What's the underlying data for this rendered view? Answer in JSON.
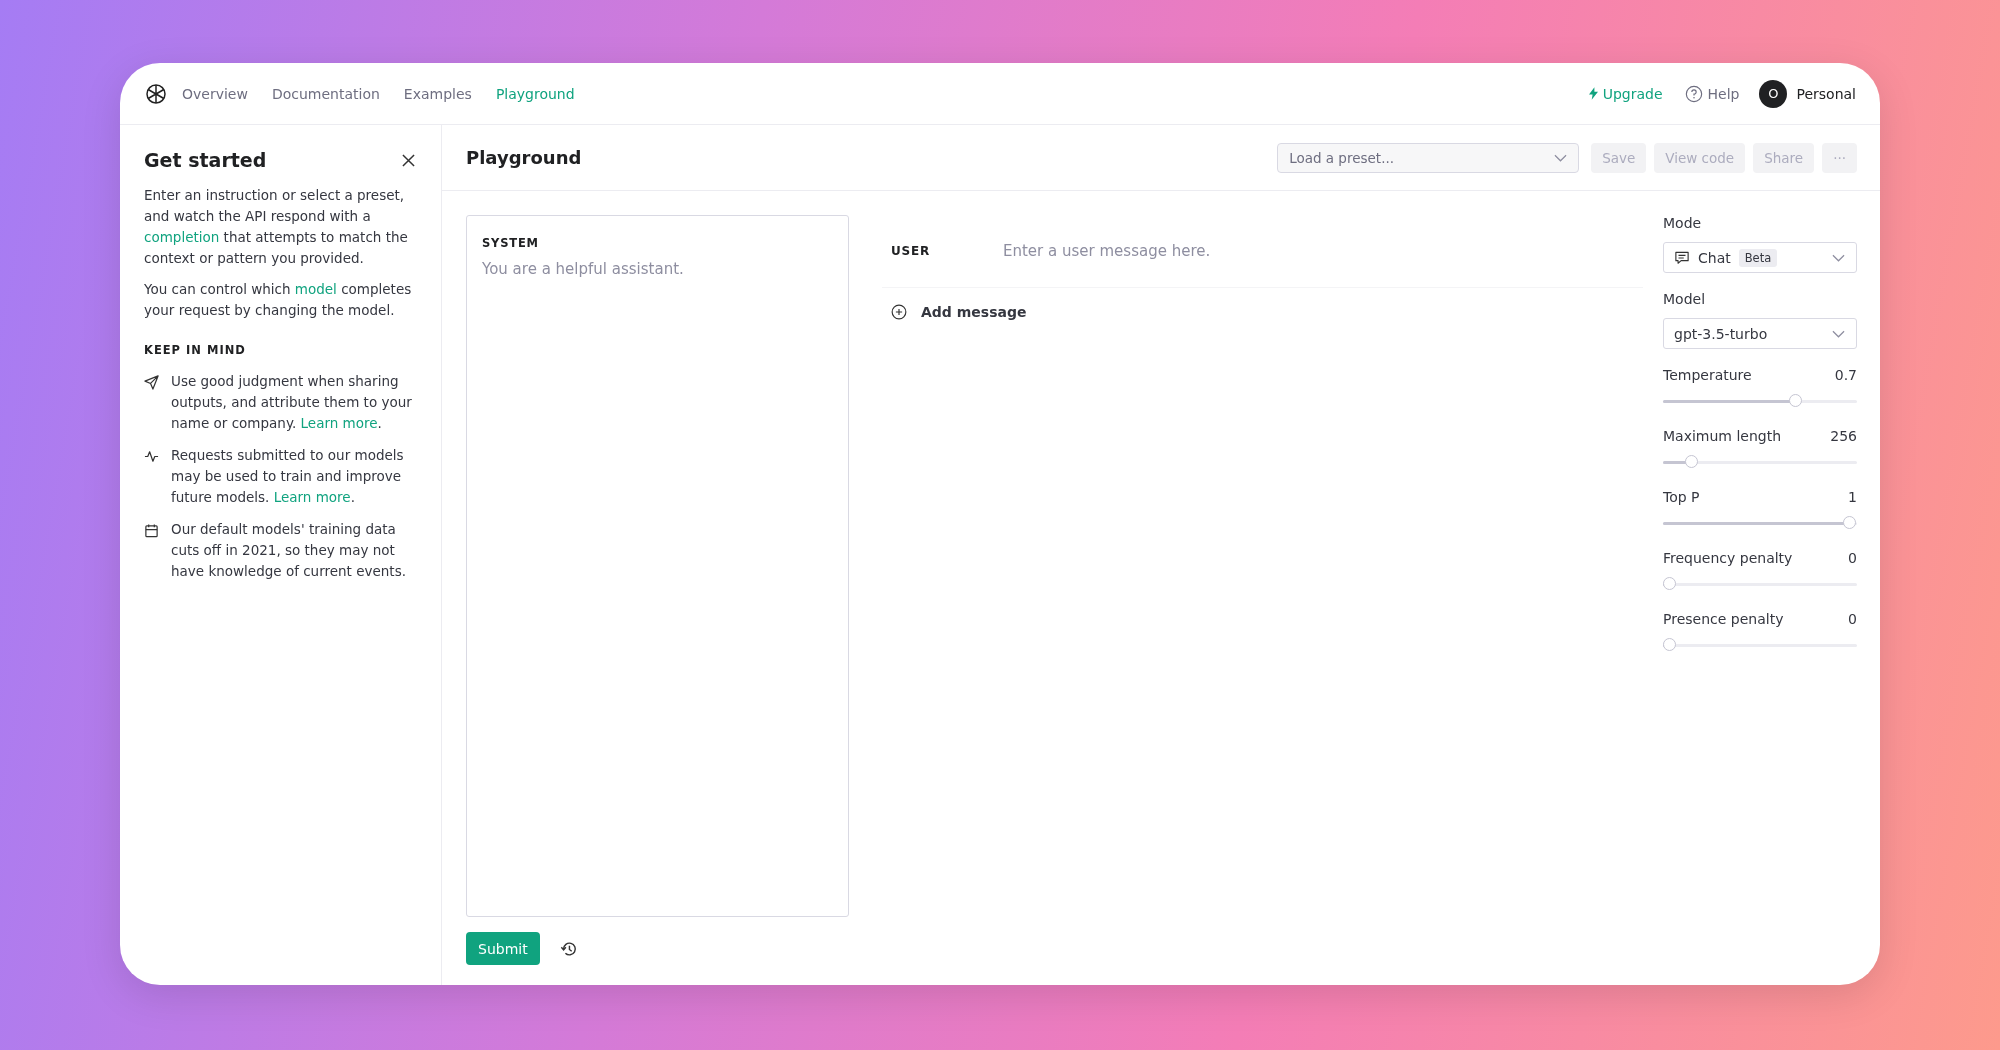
{
  "nav": {
    "tabs": [
      {
        "label": "Overview",
        "selected": false
      },
      {
        "label": "Documentation",
        "selected": false
      },
      {
        "label": "Examples",
        "selected": false
      },
      {
        "label": "Playground",
        "selected": true
      }
    ],
    "upgrade": "Upgrade",
    "help": "Help",
    "avatar": "O",
    "account": "Personal"
  },
  "sidebar": {
    "title": "Get started",
    "paragraphs": [
      [
        {
          "text": "Enter an instruction or select a preset, and watch the API respond with a ",
          "link": false
        },
        {
          "text": "completion",
          "link": true
        },
        {
          "text": " that attempts to match the context or pattern you provided.",
          "link": false
        }
      ],
      [
        {
          "text": "You can control which ",
          "link": false
        },
        {
          "text": "model",
          "link": true
        },
        {
          "text": " completes your request by changing the model.",
          "link": false
        }
      ]
    ],
    "section": "KEEP IN MIND",
    "notes": [
      {
        "kind": "send",
        "parts": [
          {
            "text": "Use good judgment when sharing outputs, and attribute them to your name or company. ",
            "link": false
          },
          {
            "text": "Learn more",
            "link": true
          },
          {
            "text": ".",
            "link": false
          }
        ]
      },
      {
        "kind": "pulse",
        "parts": [
          {
            "text": "Requests submitted to our models may be used to train and improve future models. ",
            "link": false
          },
          {
            "text": "Learn more",
            "link": true
          },
          {
            "text": ".",
            "link": false
          }
        ]
      },
      {
        "kind": "calendar",
        "parts": [
          {
            "text": "Our default models' training data cuts off in 2021, so they may not have knowledge of current events.",
            "link": false
          }
        ]
      }
    ]
  },
  "header": {
    "title": "Playground",
    "preset": {
      "placeholder": "Load a preset..."
    },
    "buttons": [
      "Save",
      "View code",
      "Share",
      "···"
    ]
  },
  "system": {
    "label": "SYSTEM",
    "placeholder": "You are a helpful assistant."
  },
  "messages": [
    {
      "role": "USER",
      "placeholder": "Enter a user message here."
    }
  ],
  "add_message": "Add message",
  "submit": "Submit",
  "settings": {
    "mode_label": "Mode",
    "mode": "Chat",
    "mode_badge": "Beta",
    "model_label": "Model",
    "model": "gpt-3.5-turbo",
    "sliders": [
      {
        "name": "Temperature",
        "reading": "0.7",
        "level": 0.7
      },
      {
        "name": "Maximum length",
        "reading": "256",
        "level": 0.12
      },
      {
        "name": "Top P",
        "reading": "1",
        "level": 1
      },
      {
        "name": "Frequency penalty",
        "reading": "0",
        "level": 0
      },
      {
        "name": "Presence penalty",
        "reading": "0",
        "level": 0
      }
    ]
  }
}
